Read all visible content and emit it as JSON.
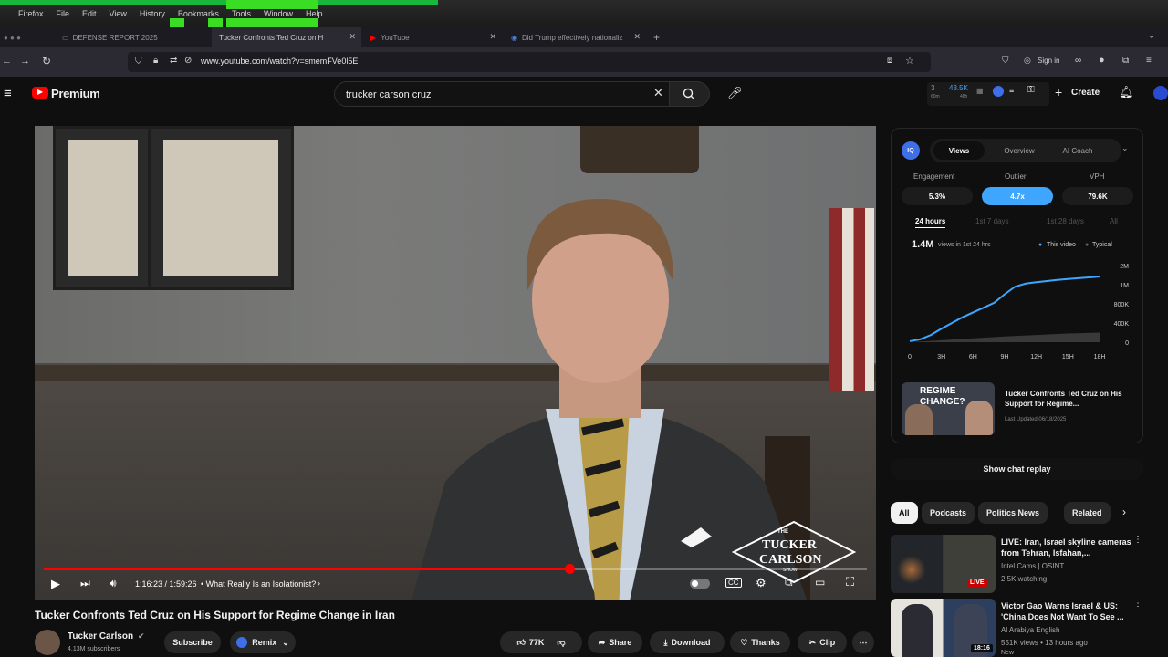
{
  "menubar": {
    "items": [
      "Firefox",
      "File",
      "Edit",
      "View",
      "History",
      "Bookmarks",
      "Tools",
      "Window",
      "Help"
    ]
  },
  "tabs": [
    {
      "label": "DEFENSE REPORT 2025",
      "active": false
    },
    {
      "label": "Tucker Confronts Ted Cruz on H",
      "active": true
    },
    {
      "label": "YouTube",
      "active": false
    },
    {
      "label": "Did Trump effectively nationaliz",
      "active": false
    }
  ],
  "address": {
    "url": "www.youtube.com/watch?v=smemFVe0l5E"
  },
  "toolbar_right": {
    "signin": "Sign in"
  },
  "yt": {
    "brand": "Premium",
    "search_value": "trucker carson  cruz",
    "ext_stats": {
      "a": "3",
      "a_sub": "60m",
      "b": "43.5K",
      "b_sub": "48h"
    },
    "create": "Create"
  },
  "player": {
    "time": "1:16:23 / 1:59:26",
    "chapter": "• What Really Is an Isolationist?",
    "progress_fraction": 0.639,
    "watermark": [
      "THE",
      "TUCKER",
      "CARLSON",
      "SHOW"
    ]
  },
  "video": {
    "title": "Tucker Confronts Ted Cruz on His Support for Regime Change in Iran",
    "channel": "Tucker Carlson",
    "subscribers": "4.13M subscribers",
    "subscribe": "Subscribe",
    "remix": "Remix",
    "likes": "77K",
    "share": "Share",
    "download": "Download",
    "thanks": "Thanks",
    "clip": "Clip"
  },
  "iq": {
    "badge": "IQ",
    "tabs": [
      "Views",
      "Overview",
      "AI Coach"
    ],
    "metrics": [
      {
        "label": "Engagement",
        "value": "5.3%"
      },
      {
        "label": "Outlier",
        "value": "4.7x"
      },
      {
        "label": "VPH",
        "value": "79.6K"
      }
    ],
    "ranges": [
      "24 hours",
      "1st 7 days",
      "1st 28 days",
      "All"
    ],
    "views_big": "1.4M",
    "views_text": "views in 1st 24 hrs",
    "legend": [
      "This video",
      "Typical"
    ],
    "card_title": "Tucker Confronts Ted Cruz on His Support for Regime...",
    "card_updated": "Last Updated 06/18/2025",
    "card_thumb_text": [
      "REGIME",
      "CHANGE?"
    ],
    "colors": {
      "accent": "#3ea6ff",
      "typical": "#555555"
    }
  },
  "chart_data": {
    "type": "line",
    "x_ticks": [
      "0",
      "3H",
      "6H",
      "9H",
      "12H",
      "15H",
      "18H"
    ],
    "y_ticks": [
      "2M",
      "1M",
      "800K",
      "400K",
      "0"
    ],
    "series": [
      {
        "name": "This video",
        "x": [
          0,
          1,
          2,
          3,
          4,
          5,
          6,
          7,
          8,
          9,
          10,
          11,
          12,
          13,
          14,
          15,
          16,
          17,
          18
        ],
        "y": [
          0.02,
          0.06,
          0.15,
          0.28,
          0.4,
          0.52,
          0.62,
          0.72,
          0.81,
          0.9,
          0.98,
          1.06,
          1.13,
          1.19,
          1.25,
          1.3,
          1.34,
          1.38,
          1.42
        ]
      },
      {
        "name": "Typical",
        "x": [
          0,
          3,
          6,
          9,
          12,
          15,
          18
        ],
        "y": [
          0.0,
          0.04,
          0.08,
          0.12,
          0.15,
          0.18,
          0.2
        ]
      }
    ]
  },
  "chat": {
    "replay": "Show chat replay"
  },
  "chips": [
    "All",
    "Podcasts",
    "Politics News",
    "Related"
  ],
  "related": [
    {
      "title": "LIVE: Iran, Israel skyline cameras from Tehran, Isfahan,...",
      "channel": "Intel Cams | OSINT",
      "meta": "2.5K watching",
      "badge": "LIVE"
    },
    {
      "title": "Victor Gao Warns Israel & US: 'China Does Not Want To See ...",
      "channel": "Al Arabiya English",
      "meta": "551K views • 13 hours ago",
      "badge": "18:16",
      "extra": "New"
    }
  ]
}
